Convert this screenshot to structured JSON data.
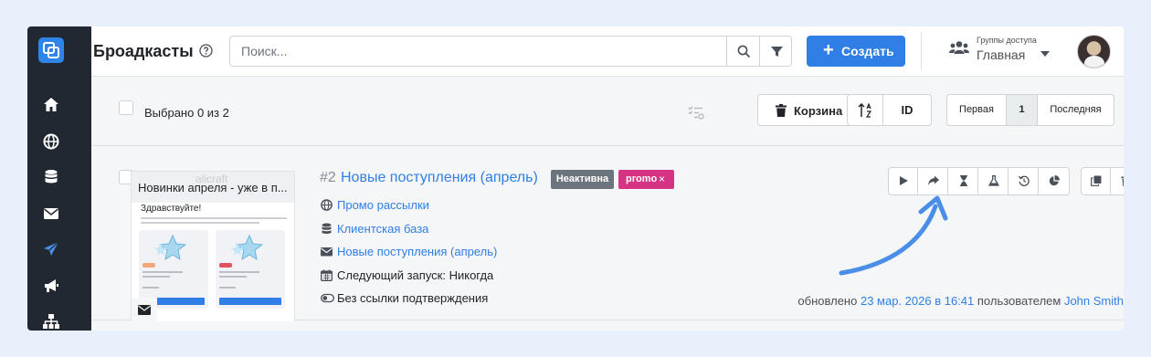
{
  "header": {
    "title": "Броадкасты",
    "search_placeholder": "Поиск...",
    "create_label": "Создать",
    "access_group_caption": "Группы доступа",
    "access_group_value": "Главная"
  },
  "toolbar": {
    "selected_text": "Выбрано 0 из 2",
    "trash_label": "Корзина",
    "sort_field": "ID",
    "pager": {
      "first": "Первая",
      "current": "1",
      "last": "Последняя"
    }
  },
  "broadcast": {
    "id": "#2",
    "name": "Новые поступления (апрель)",
    "status": "Неактивна",
    "tag": "promo",
    "tag_remove": "×",
    "thumb": {
      "title": "Новинки апреля - уже в п...",
      "watermark": "alicraft",
      "greeting": "Здравствуйте!"
    },
    "channel": "Промо рассылки",
    "audience": "Клиентская база",
    "template": "Новые поступления (апрель)",
    "next_run": "Следующий запуск: Никогда",
    "confirmation": "Без ссылки подтверждения",
    "updated_prefix": "обновлено",
    "updated_date": "23 мар. 2026 в 16:41",
    "updated_by_prefix": "пользователем",
    "updated_by": "John Smith"
  },
  "colors": {
    "accent": "#2f7fe6",
    "sidebar": "#212831",
    "status_inactive": "#6c757d",
    "tag_promo": "#d63384",
    "annotation_arrow": "#4a8ee8"
  },
  "icons": {
    "sidebar": [
      "home-icon",
      "globe-icon",
      "database-icon",
      "envelope-icon",
      "paper-plane-icon",
      "megaphone-icon",
      "sitemap-icon"
    ],
    "actions": [
      "play-icon",
      "share-icon",
      "hourglass-icon",
      "flask-icon",
      "history-icon",
      "pie-chart-icon"
    ],
    "extra_actions": [
      "copy-icon",
      "trash-icon"
    ]
  }
}
